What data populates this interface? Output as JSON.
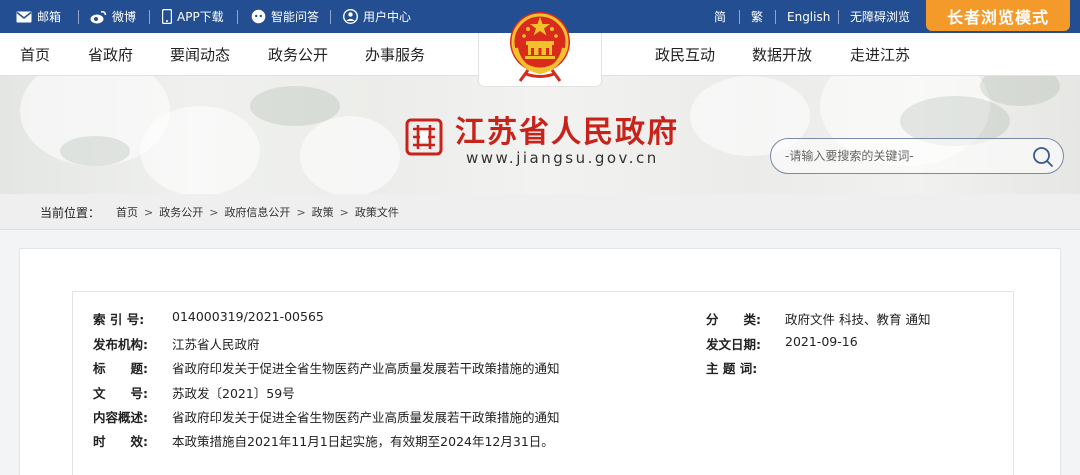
{
  "topbar": {
    "mail": "邮箱",
    "weibo": "微博",
    "app": "APP下载",
    "qa": "智能问答",
    "user": "用户中心",
    "lang_simplified": "简",
    "lang_traditional": "繁",
    "lang_english": "English",
    "accessibility": "无障碍浏览",
    "elder_mode": "长者浏览模式"
  },
  "nav": {
    "home": "首页",
    "province_gov": "省政府",
    "news": "要闻动态",
    "gov_affairs": "政务公开",
    "services": "办事服务",
    "interaction": "政民互动",
    "open_data": "数据开放",
    "about": "走进江苏"
  },
  "banner": {
    "site_title": "江苏省人民政府",
    "site_url": "www.jiangsu.gov.cn",
    "search_placeholder": "-请输入要搜索的关键词-"
  },
  "breadcrumb": {
    "label": "当前位置：",
    "items": [
      "首页",
      "政务公开",
      "政府信息公开",
      "政策",
      "政策文件"
    ]
  },
  "doc": {
    "index_label": "索 引 号:",
    "index_value": "014000319/2021-00565",
    "publisher_label": "发布机构:",
    "publisher_value": "江苏省人民政府",
    "title_label": "标　　题:",
    "title_value": "省政府印发关于促进全省生物医药产业高质量发展若干政策措施的通知",
    "docno_label": "文　　号:",
    "docno_value": "苏政发〔2021〕59号",
    "summary_label": "内容概述:",
    "summary_value": "省政府印发关于促进全省生物医药产业高质量发展若干政策措施的通知",
    "validity_label": "时　　效:",
    "validity_value": "本政策措施自2021年11月1日起实施，有效期至2024年12月31日。",
    "category_label": "分　　类:",
    "category_value": "政府文件 科技、教育 通知",
    "date_label": "发文日期:",
    "date_value": "2021-09-16",
    "subject_label": "主 题 词:",
    "subject_value": ""
  },
  "colors": {
    "topbar": "#234f92",
    "elder_button": "#f39a2a",
    "title_red": "#c8231a"
  }
}
